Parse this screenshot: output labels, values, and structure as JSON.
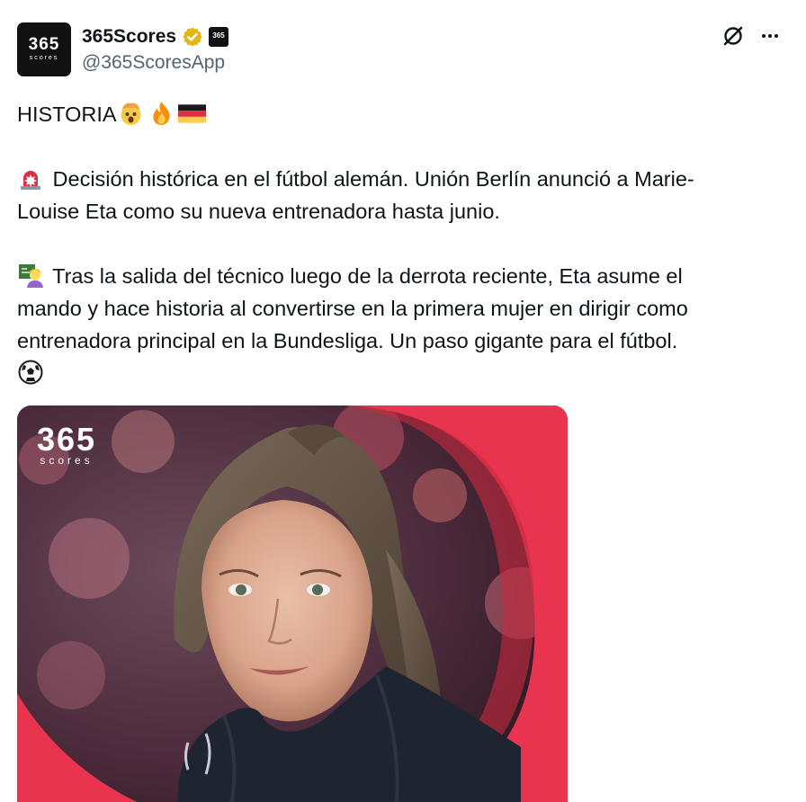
{
  "author": {
    "display_name": "365Scores",
    "handle": "@365ScoresApp",
    "avatar_logo_number": "365",
    "avatar_logo_sub": "scores",
    "affiliate_badge_text": "365",
    "verified_color": "#e2b719"
  },
  "actions": {
    "grok_icon": "grok-icon",
    "more_icon": "more-icon"
  },
  "tweet": {
    "line1": "HISTORIA",
    "para1_line1": " Decisión histórica en el fútbol alemán. Unión Berlín anunció a Marie-",
    "para1_line2": "Louise Eta como su nueva entrenadora hasta junio.",
    "para2_line1": " Tras la salida del técnico luego de la derrota reciente, Eta asume el",
    "para2_line2": "mando y hace historia al convertirse en la primera mujer en dirigir como",
    "para2_line3": "entrenadora principal en la Bundesliga. Un paso gigante para el fútbol."
  },
  "media": {
    "logo_number": "365",
    "logo_sub": "scores",
    "accent_color": "#e8344e"
  }
}
